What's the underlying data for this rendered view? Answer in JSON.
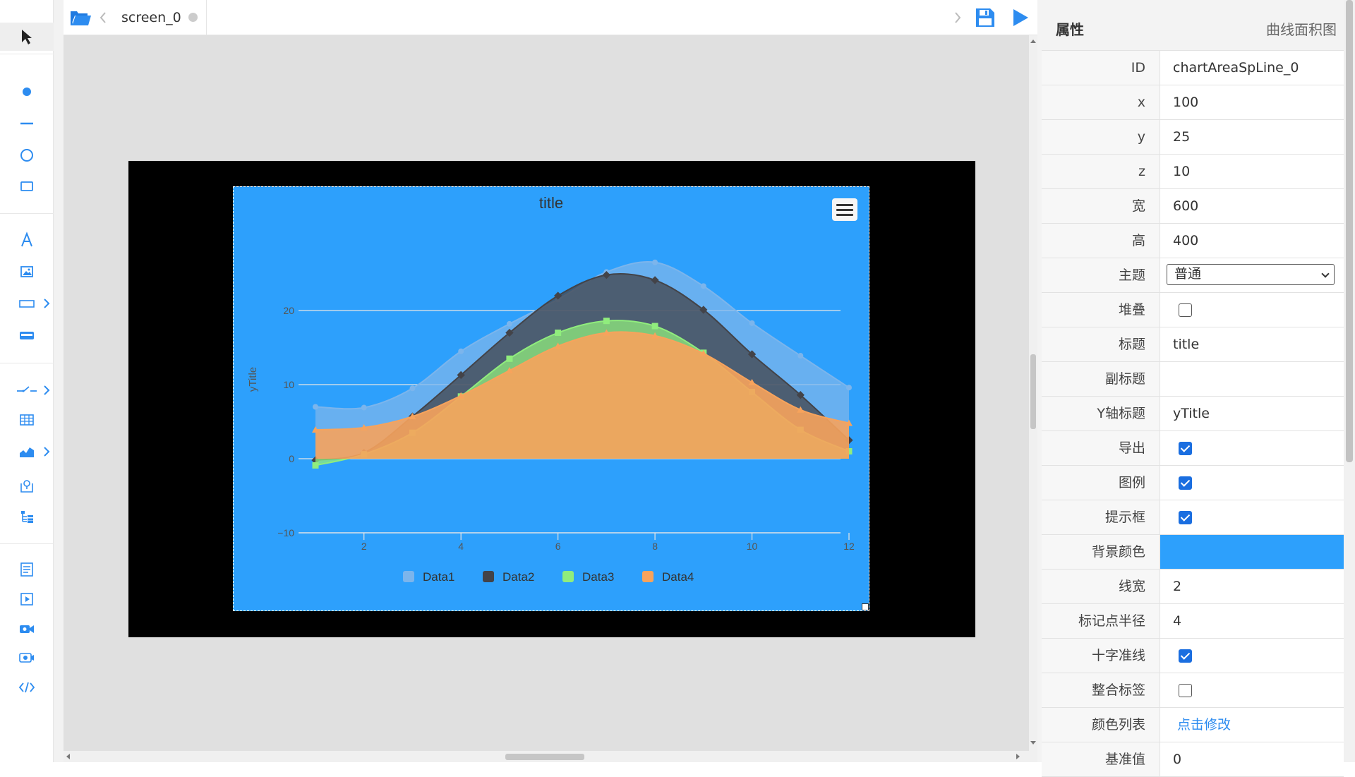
{
  "tab": {
    "label": "screen_0"
  },
  "left_toolbar": {
    "tools": [
      "pointer-icon",
      "dot-icon",
      "line-icon",
      "circle-icon",
      "rectangle-icon",
      "text-icon",
      "image-icon",
      "input-box-icon",
      "button-icon",
      "switch-icon",
      "table-icon",
      "chart-icon",
      "map-icon",
      "tree-icon",
      "form-icon",
      "video-icon",
      "camera-icon",
      "window-icon",
      "code-icon"
    ]
  },
  "colors": {
    "chart_bg": "#2da0fc",
    "accent": "#1a6ee0",
    "link": "#2d8cf0",
    "data1": "#7cb5ec",
    "data2": "#434348",
    "data3": "#90ed7d",
    "data4": "#f7a35c"
  },
  "panel": {
    "title": "属性",
    "component_type": "曲线面积图",
    "rows": [
      {
        "label": "ID",
        "value": "chartAreaSpLine_0",
        "kind": "text"
      },
      {
        "label": "x",
        "value": "100",
        "kind": "text"
      },
      {
        "label": "y",
        "value": "25",
        "kind": "text"
      },
      {
        "label": "z",
        "value": "10",
        "kind": "text"
      },
      {
        "label": "宽",
        "value": "600",
        "kind": "text"
      },
      {
        "label": "高",
        "value": "400",
        "kind": "text"
      },
      {
        "label": "主题",
        "value": "普通",
        "kind": "select"
      },
      {
        "label": "堆叠",
        "checked": false,
        "kind": "checkbox"
      },
      {
        "label": "标题",
        "value": "title",
        "kind": "text"
      },
      {
        "label": "副标题",
        "value": "",
        "kind": "text"
      },
      {
        "label": "Y轴标题",
        "value": "yTitle",
        "kind": "text"
      },
      {
        "label": "导出",
        "checked": true,
        "kind": "checkbox"
      },
      {
        "label": "图例",
        "checked": true,
        "kind": "checkbox"
      },
      {
        "label": "提示框",
        "checked": true,
        "kind": "checkbox"
      },
      {
        "label": "背景颜色",
        "value": "#2da0fc",
        "kind": "color"
      },
      {
        "label": "线宽",
        "value": "2",
        "kind": "text"
      },
      {
        "label": "标记点半径",
        "value": "4",
        "kind": "text"
      },
      {
        "label": "十字准线",
        "checked": true,
        "kind": "checkbox"
      },
      {
        "label": "整合标签",
        "checked": false,
        "kind": "checkbox"
      },
      {
        "label": "颜色列表",
        "value": "点击修改",
        "kind": "link"
      },
      {
        "label": "基准值",
        "value": "0",
        "kind": "text"
      }
    ]
  },
  "chart_data": {
    "type": "area",
    "title": "title",
    "ylabel": "yTitle",
    "x": [
      1,
      2,
      3,
      4,
      5,
      6,
      7,
      8,
      9,
      10,
      11,
      12
    ],
    "xticks": [
      "2",
      "4",
      "6",
      "8",
      "10",
      "12"
    ],
    "yticks": [
      "−10",
      "0",
      "10",
      "20"
    ],
    "ylim": [
      -10,
      20
    ],
    "grid": true,
    "legend_position": "bottom",
    "series": [
      {
        "name": "Data1",
        "color": "#7cb5ec",
        "values": [
          7,
          6.9,
          9.5,
          14.5,
          18.2,
          21.5,
          25.2,
          26.5,
          23.3,
          18.3,
          13.9,
          9.6
        ]
      },
      {
        "name": "Data2",
        "color": "#434348",
        "values": [
          -0.2,
          0.8,
          5.7,
          11.3,
          17,
          22,
          24.8,
          24.1,
          20.1,
          14.1,
          8.6,
          2.5
        ]
      },
      {
        "name": "Data3",
        "color": "#90ed7d",
        "values": [
          -0.9,
          0.6,
          3.5,
          8.4,
          13.5,
          17,
          18.6,
          17.9,
          14.3,
          9,
          3.9,
          1
        ]
      },
      {
        "name": "Data4",
        "color": "#f7a35c",
        "values": [
          3.9,
          4.2,
          5.7,
          8.5,
          11.9,
          15.2,
          17,
          16.6,
          14.2,
          10.3,
          6.6,
          4.8
        ]
      }
    ]
  }
}
